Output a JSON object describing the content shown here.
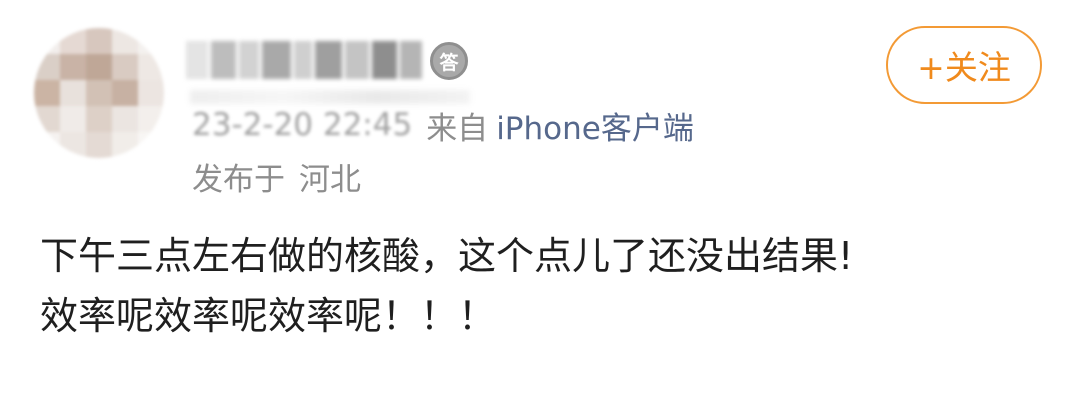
{
  "user": {
    "badge_text": "答"
  },
  "follow_button": {
    "label": "+关注"
  },
  "meta": {
    "time": "23-2-20 22:45",
    "from_label": "来自",
    "client": "iPhone客户端"
  },
  "location": {
    "label": "发布于",
    "value": "河北"
  },
  "post": {
    "line1": "下午三点左右做的核酸，这个点儿了还没出结果!",
    "line2": "效率呢效率呢效率呢！！！"
  },
  "colors": {
    "accent_orange": "#f39a35",
    "link_blue": "#56688c",
    "meta_gray": "#8d8d8d",
    "text_dark": "#1f1f1f"
  }
}
